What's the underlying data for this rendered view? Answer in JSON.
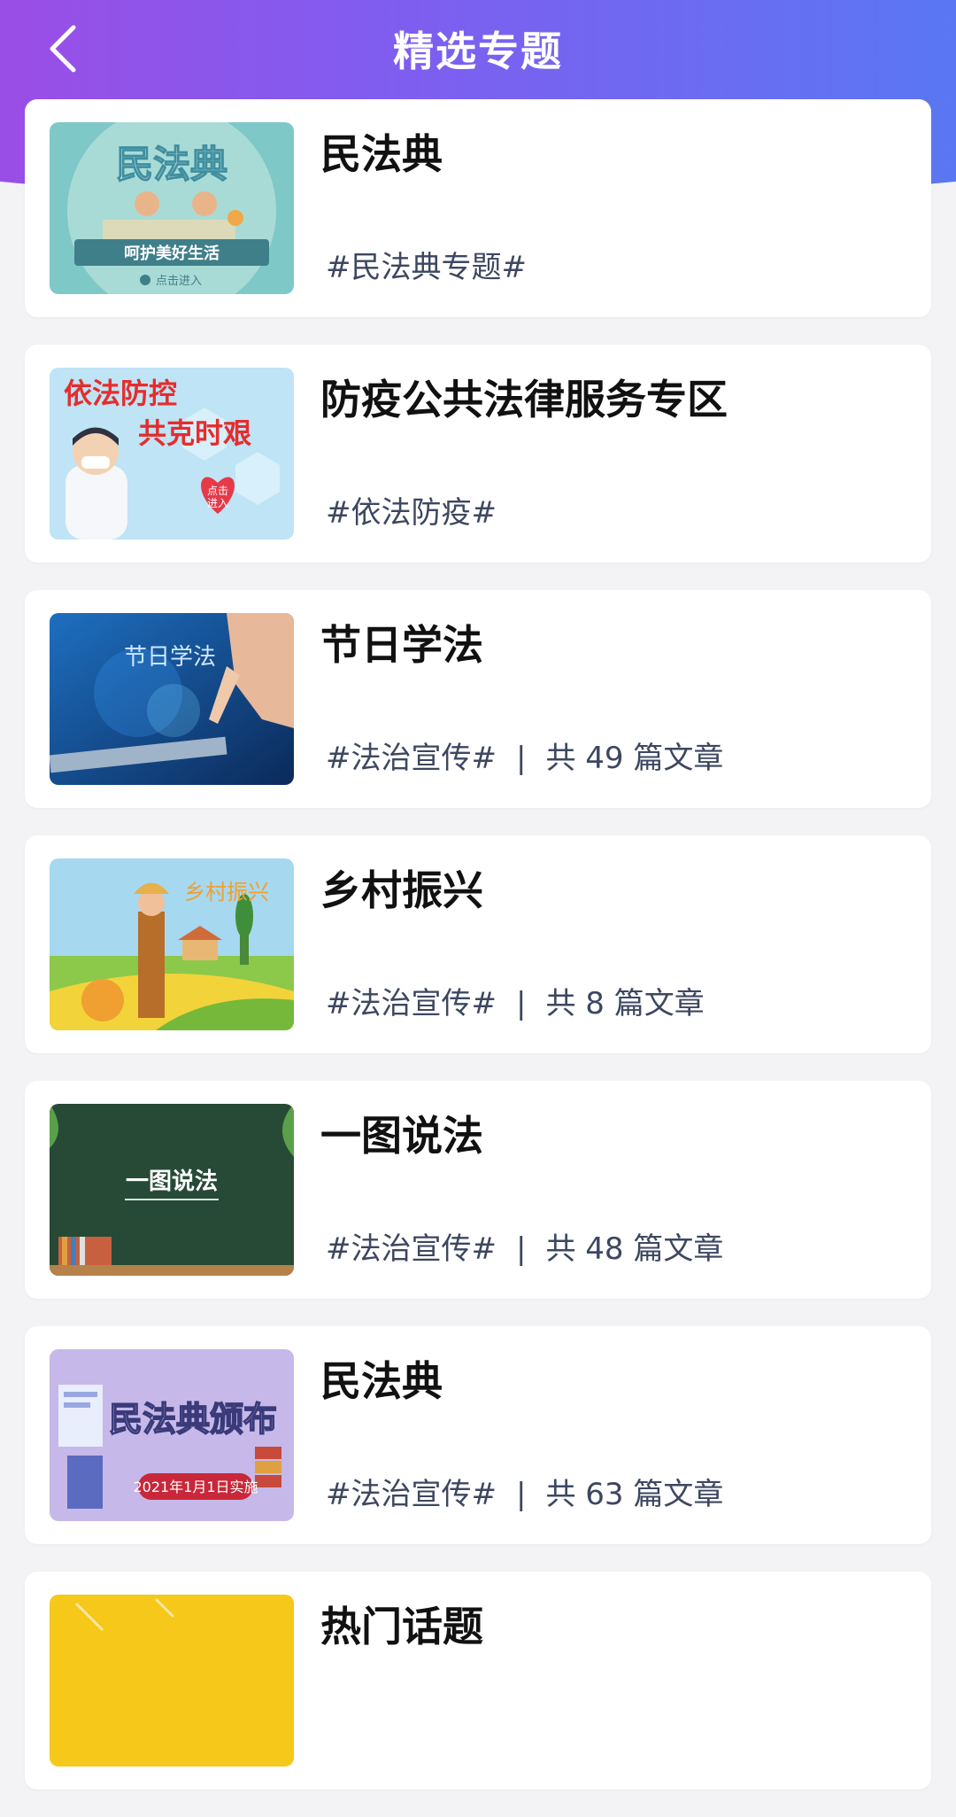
{
  "header": {
    "title": "精选专题",
    "back_icon": "chevron-left-icon",
    "gradient_start": "#9a4ee6",
    "gradient_end": "#5a77f2"
  },
  "topics": [
    {
      "title": "民法典",
      "tag": "#民法典专题#",
      "thumb_text": {
        "title": "民法典",
        "banner": "呵护美好生活",
        "cta": "点击进入"
      }
    },
    {
      "title": "防疫公共法律服务专区",
      "tag": "#依法防疫#",
      "thumb_text": {
        "line1": "依法防控",
        "line2": "共克时艰",
        "cta_line1": "点击",
        "cta_line2": "进入"
      }
    },
    {
      "title": "节日学法",
      "tag": "#法治宣传#",
      "separator": "|",
      "count": "共 49 篇文章",
      "thumb_text": {
        "title": "节日学法"
      }
    },
    {
      "title": "乡村振兴",
      "tag": "#法治宣传#",
      "separator": "|",
      "count": "共 8 篇文章",
      "thumb_text": {
        "title": "乡村振兴"
      }
    },
    {
      "title": "一图说法",
      "tag": "#法治宣传#",
      "separator": "|",
      "count": "共 48 篇文章",
      "thumb_text": {
        "title": "一图说法"
      }
    },
    {
      "title": "民法典",
      "tag": "#法治宣传#",
      "separator": "|",
      "count": "共 63 篇文章",
      "thumb_text": {
        "title": "民法典颁布",
        "date": "2021年1月1日实施"
      }
    },
    {
      "title": "热门话题"
    }
  ]
}
